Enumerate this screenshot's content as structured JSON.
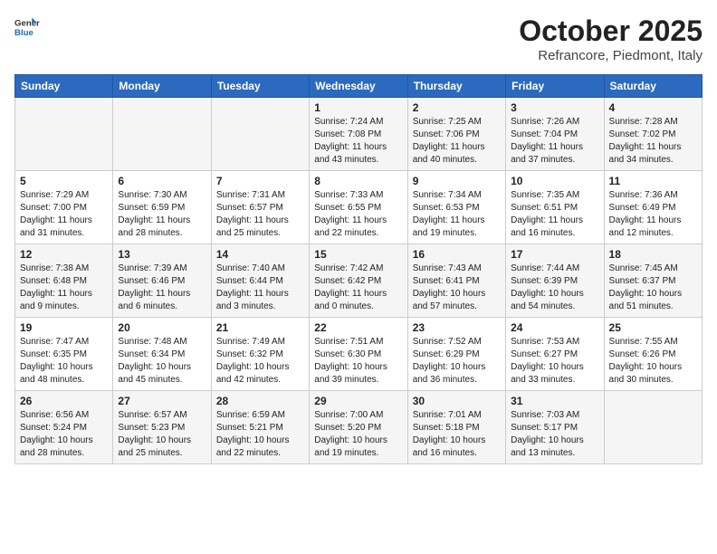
{
  "header": {
    "logo_general": "General",
    "logo_blue": "Blue",
    "month": "October 2025",
    "location": "Refrancore, Piedmont, Italy"
  },
  "days_of_week": [
    "Sunday",
    "Monday",
    "Tuesday",
    "Wednesday",
    "Thursday",
    "Friday",
    "Saturday"
  ],
  "weeks": [
    [
      {
        "num": "",
        "info": ""
      },
      {
        "num": "",
        "info": ""
      },
      {
        "num": "",
        "info": ""
      },
      {
        "num": "1",
        "info": "Sunrise: 7:24 AM\nSunset: 7:08 PM\nDaylight: 11 hours and 43 minutes."
      },
      {
        "num": "2",
        "info": "Sunrise: 7:25 AM\nSunset: 7:06 PM\nDaylight: 11 hours and 40 minutes."
      },
      {
        "num": "3",
        "info": "Sunrise: 7:26 AM\nSunset: 7:04 PM\nDaylight: 11 hours and 37 minutes."
      },
      {
        "num": "4",
        "info": "Sunrise: 7:28 AM\nSunset: 7:02 PM\nDaylight: 11 hours and 34 minutes."
      }
    ],
    [
      {
        "num": "5",
        "info": "Sunrise: 7:29 AM\nSunset: 7:00 PM\nDaylight: 11 hours and 31 minutes."
      },
      {
        "num": "6",
        "info": "Sunrise: 7:30 AM\nSunset: 6:59 PM\nDaylight: 11 hours and 28 minutes."
      },
      {
        "num": "7",
        "info": "Sunrise: 7:31 AM\nSunset: 6:57 PM\nDaylight: 11 hours and 25 minutes."
      },
      {
        "num": "8",
        "info": "Sunrise: 7:33 AM\nSunset: 6:55 PM\nDaylight: 11 hours and 22 minutes."
      },
      {
        "num": "9",
        "info": "Sunrise: 7:34 AM\nSunset: 6:53 PM\nDaylight: 11 hours and 19 minutes."
      },
      {
        "num": "10",
        "info": "Sunrise: 7:35 AM\nSunset: 6:51 PM\nDaylight: 11 hours and 16 minutes."
      },
      {
        "num": "11",
        "info": "Sunrise: 7:36 AM\nSunset: 6:49 PM\nDaylight: 11 hours and 12 minutes."
      }
    ],
    [
      {
        "num": "12",
        "info": "Sunrise: 7:38 AM\nSunset: 6:48 PM\nDaylight: 11 hours and 9 minutes."
      },
      {
        "num": "13",
        "info": "Sunrise: 7:39 AM\nSunset: 6:46 PM\nDaylight: 11 hours and 6 minutes."
      },
      {
        "num": "14",
        "info": "Sunrise: 7:40 AM\nSunset: 6:44 PM\nDaylight: 11 hours and 3 minutes."
      },
      {
        "num": "15",
        "info": "Sunrise: 7:42 AM\nSunset: 6:42 PM\nDaylight: 11 hours and 0 minutes."
      },
      {
        "num": "16",
        "info": "Sunrise: 7:43 AM\nSunset: 6:41 PM\nDaylight: 10 hours and 57 minutes."
      },
      {
        "num": "17",
        "info": "Sunrise: 7:44 AM\nSunset: 6:39 PM\nDaylight: 10 hours and 54 minutes."
      },
      {
        "num": "18",
        "info": "Sunrise: 7:45 AM\nSunset: 6:37 PM\nDaylight: 10 hours and 51 minutes."
      }
    ],
    [
      {
        "num": "19",
        "info": "Sunrise: 7:47 AM\nSunset: 6:35 PM\nDaylight: 10 hours and 48 minutes."
      },
      {
        "num": "20",
        "info": "Sunrise: 7:48 AM\nSunset: 6:34 PM\nDaylight: 10 hours and 45 minutes."
      },
      {
        "num": "21",
        "info": "Sunrise: 7:49 AM\nSunset: 6:32 PM\nDaylight: 10 hours and 42 minutes."
      },
      {
        "num": "22",
        "info": "Sunrise: 7:51 AM\nSunset: 6:30 PM\nDaylight: 10 hours and 39 minutes."
      },
      {
        "num": "23",
        "info": "Sunrise: 7:52 AM\nSunset: 6:29 PM\nDaylight: 10 hours and 36 minutes."
      },
      {
        "num": "24",
        "info": "Sunrise: 7:53 AM\nSunset: 6:27 PM\nDaylight: 10 hours and 33 minutes."
      },
      {
        "num": "25",
        "info": "Sunrise: 7:55 AM\nSunset: 6:26 PM\nDaylight: 10 hours and 30 minutes."
      }
    ],
    [
      {
        "num": "26",
        "info": "Sunrise: 6:56 AM\nSunset: 5:24 PM\nDaylight: 10 hours and 28 minutes."
      },
      {
        "num": "27",
        "info": "Sunrise: 6:57 AM\nSunset: 5:23 PM\nDaylight: 10 hours and 25 minutes."
      },
      {
        "num": "28",
        "info": "Sunrise: 6:59 AM\nSunset: 5:21 PM\nDaylight: 10 hours and 22 minutes."
      },
      {
        "num": "29",
        "info": "Sunrise: 7:00 AM\nSunset: 5:20 PM\nDaylight: 10 hours and 19 minutes."
      },
      {
        "num": "30",
        "info": "Sunrise: 7:01 AM\nSunset: 5:18 PM\nDaylight: 10 hours and 16 minutes."
      },
      {
        "num": "31",
        "info": "Sunrise: 7:03 AM\nSunset: 5:17 PM\nDaylight: 10 hours and 13 minutes."
      },
      {
        "num": "",
        "info": ""
      }
    ]
  ]
}
